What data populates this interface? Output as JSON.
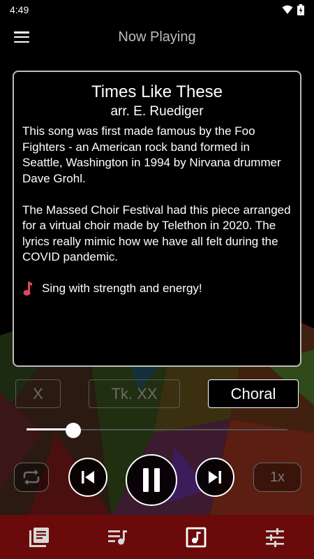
{
  "status_bar": {
    "time": "4:49",
    "icons": [
      "wifi-icon",
      "battery-charging-icon"
    ]
  },
  "app_bar": {
    "title": "Now Playing",
    "menu_icon": "hamburger-menu-icon"
  },
  "song": {
    "title": "Times Like These",
    "arranger": "arr. E. Ruediger",
    "description": [
      "This song was first made famous by the Foo Fighters - an American rock band formed in Seattle, Washington in 1994 by Nirvana drummer Dave Grohl.",
      "The Massed Choir Festival had this piece arranged for a virtual choir made by Telethon in 2020. The lyrics really mimic how we have all felt during the COVID pandemic."
    ],
    "tip": "Sing with strength and energy!",
    "tip_icon": "music-note-icon"
  },
  "chips": {
    "x_label": "X",
    "track_label": "Tk. XX",
    "mode_label": "Choral"
  },
  "seek": {
    "progress": 0.18
  },
  "controls": {
    "repeat_icon": "repeat-icon",
    "previous_icon": "skip-previous-icon",
    "play_pause_icon": "pause-icon",
    "next_icon": "skip-next-icon",
    "speed_label": "1x"
  },
  "bottom_nav": {
    "items": [
      "library-icon",
      "playlist-icon",
      "music-note-box-icon",
      "equalizer-settings-icon"
    ]
  },
  "colors": {
    "nav_background": "#6b0a0a",
    "tip_icon": "#e0475b",
    "card_border": "#bdbdbd"
  }
}
